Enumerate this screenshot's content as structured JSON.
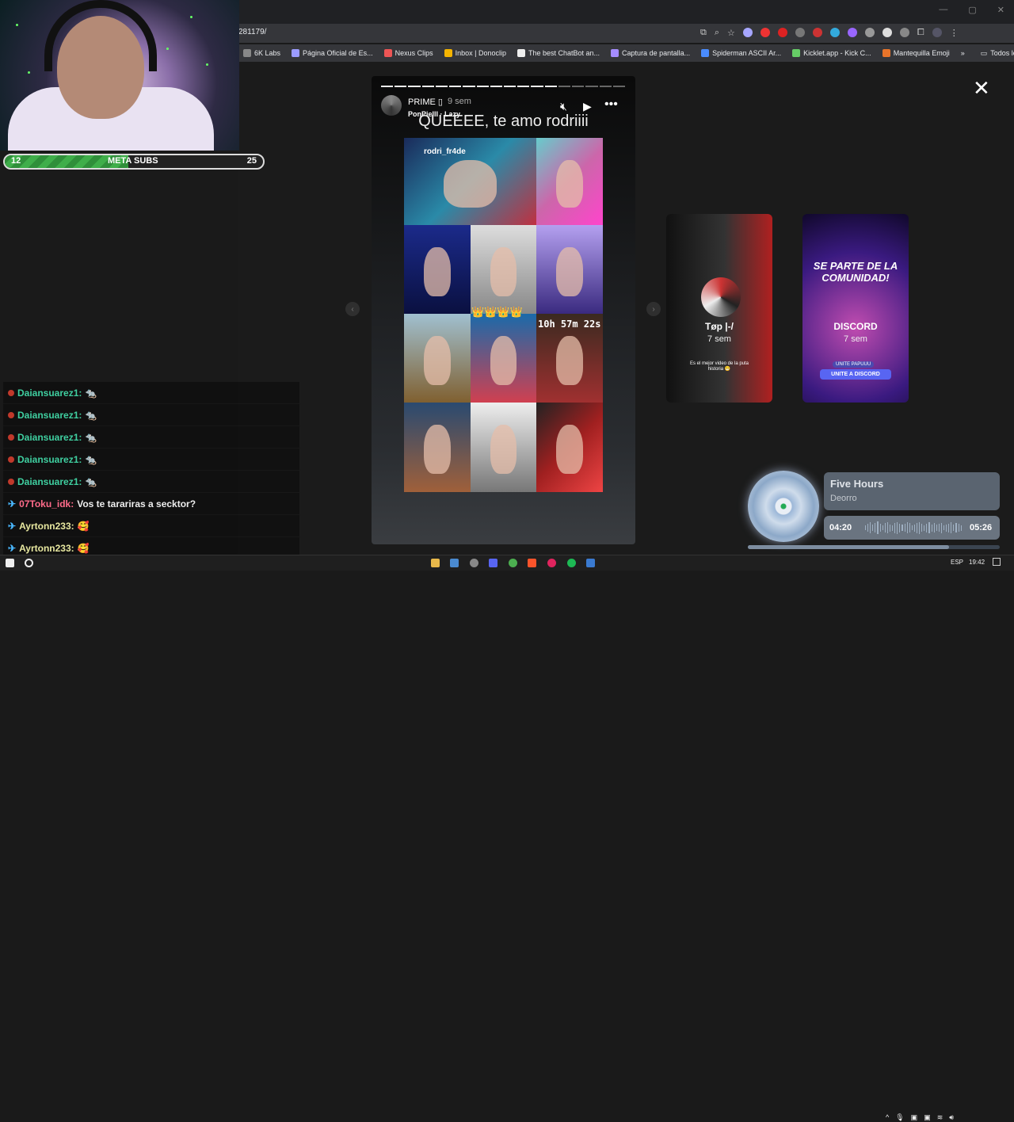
{
  "browser": {
    "url": "281179/",
    "bookmarks": [
      "6K Labs",
      "Página Oficial de Es...",
      "Nexus Clips",
      "Inbox | Donoclip",
      "The best ChatBot an...",
      "Captura de pantalla...",
      "Spiderman ASCII Ar...",
      "Kicklet.app - Kick C...",
      "Mantequilla Emoji"
    ],
    "bookmarks_overflow": "»",
    "all_bookmarks": "Todos los marcadores",
    "bookmark_colors": [
      "#888",
      "#9b9bff",
      "#e55",
      "#f5b400",
      "#eee",
      "#a58cff",
      "#4a8cff",
      "#6c6",
      "#e8742a"
    ]
  },
  "stream": {
    "subs_current": "12",
    "subs_label": "META SUBS",
    "subs_goal": "25",
    "subs_progress": 0.48
  },
  "chat": [
    {
      "user": "Daiansuarez1:",
      "text": "🐀",
      "color": "#3fcfa0"
    },
    {
      "user": "Daiansuarez1:",
      "text": "🐀",
      "color": "#3fcfa0"
    },
    {
      "user": "Daiansuarez1:",
      "text": "🐀",
      "color": "#3fcfa0"
    },
    {
      "user": "Daiansuarez1:",
      "text": "🐀",
      "color": "#3fcfa0"
    },
    {
      "user": "Daiansuarez1:",
      "text": "🐀",
      "color": "#3fcfa0"
    },
    {
      "user": "07Toku_idk:",
      "text": "Vos te tarariras a secktor?",
      "color": "#ff6b8a"
    },
    {
      "user": "Ayrtonn233:",
      "text": "🥰",
      "color": "#e8e8a0"
    },
    {
      "user": "Ayrtonn233:",
      "text": "🥰",
      "color": "#e8e8a0"
    }
  ],
  "story": {
    "username": "PRIME ▯",
    "time": "9 sem",
    "song": "PonPiellI · Lazy",
    "caption": "QUEEEE, te amo rodriiii",
    "collage_user": "rodri_fr4de",
    "collage_timer": "10h 57m 22s",
    "crowns": "👑👑👑👑",
    "segments_total": 18,
    "segments_seen": 13
  },
  "side_stories": [
    {
      "name": "Tøp |-/",
      "time": "7 sem",
      "caption": "Es el mejor video de la puta historia 😁"
    },
    {
      "name": "DISCORD",
      "time": "7 sem",
      "banner": "SE PARTE DE LA COMUNIDAD!",
      "button": "UNITE A DISCORD",
      "tag": "UNITE PAPUUU"
    }
  ],
  "music": {
    "title": "Five Hours",
    "artist": "Deorro",
    "current": "04:20",
    "total": "05:26",
    "progress": 0.8
  },
  "taskbar": {
    "lang": "ESP",
    "time": "19:42"
  }
}
